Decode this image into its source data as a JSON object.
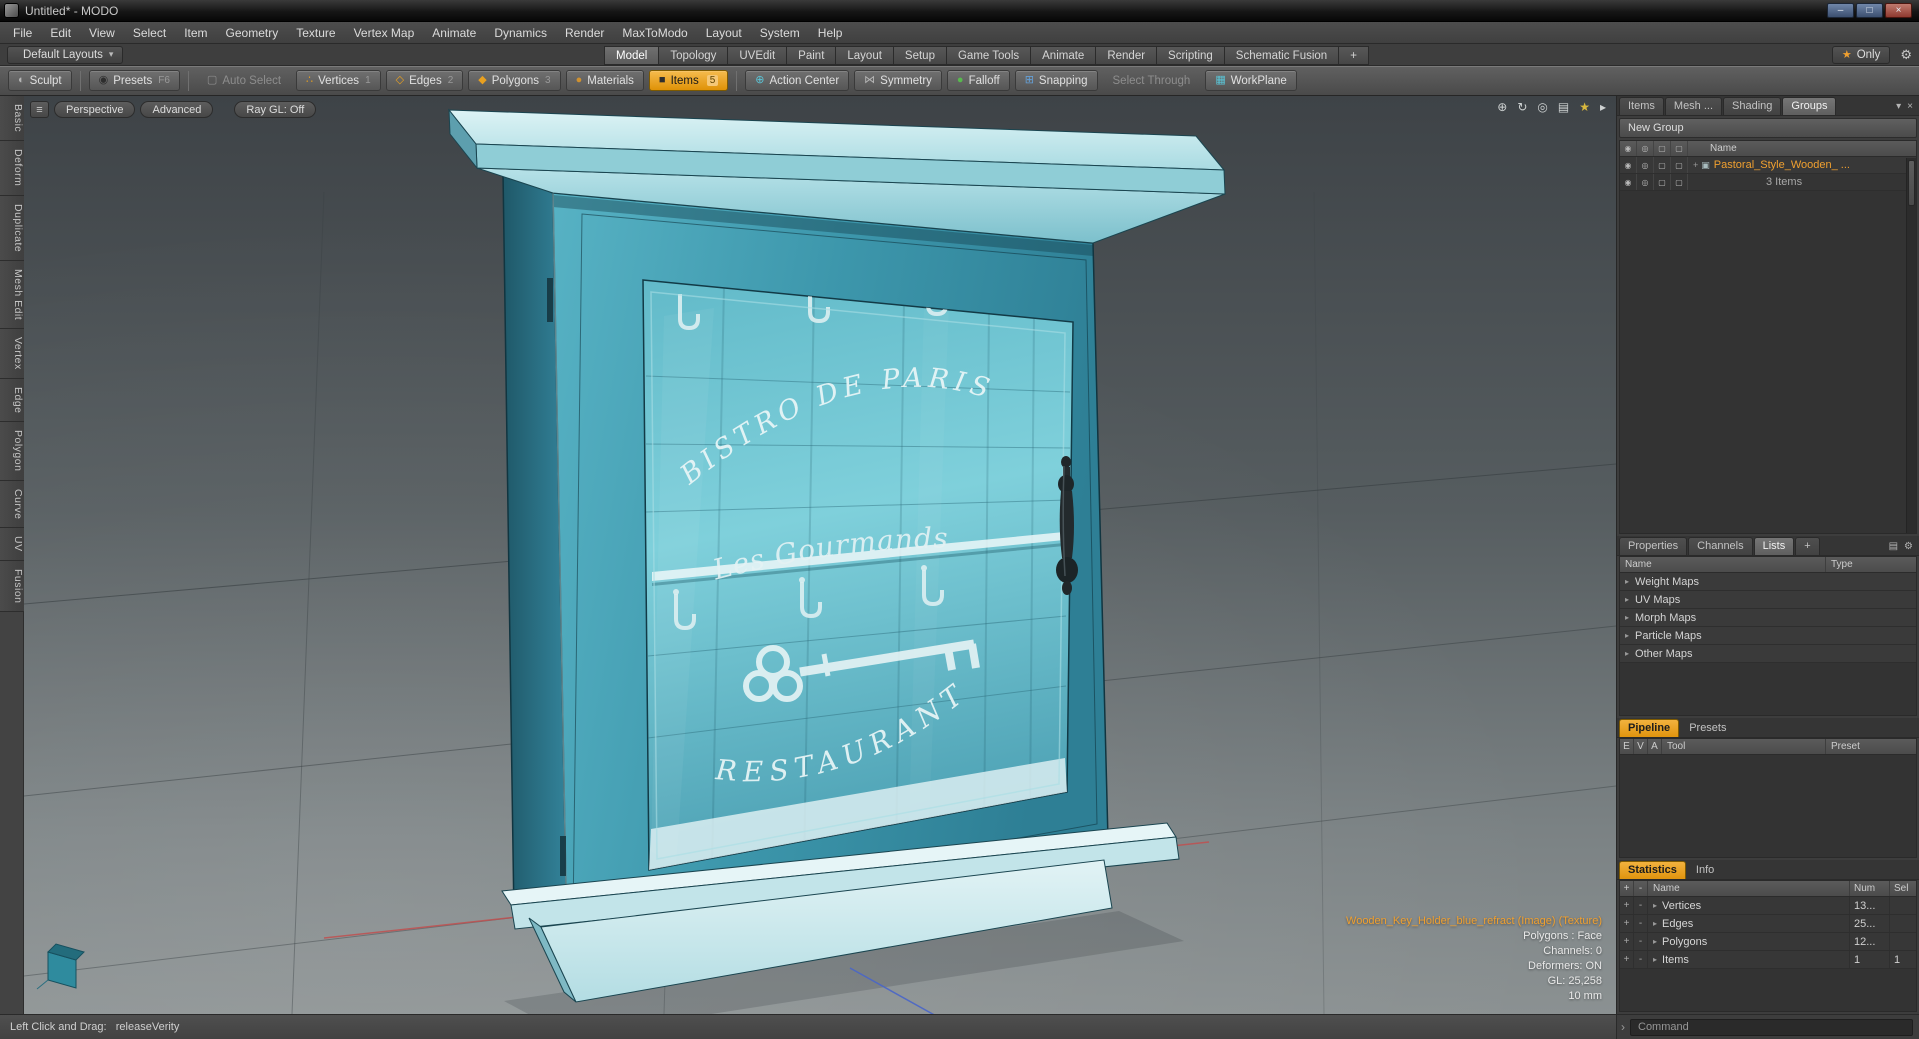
{
  "window": {
    "title": "Untitled* - MODO"
  },
  "icons": {
    "minimize": "–",
    "maximize": "□",
    "close": "×",
    "dropdown": "▾",
    "star": "★",
    "gear": "⚙",
    "pin": "▪",
    "sculpt": "◐",
    "presets": "◉",
    "auto_select": "▢",
    "vertices": "∴",
    "edges": "◇",
    "polygons": "◆",
    "materials": "●",
    "items": "■",
    "action_center": "⊕",
    "symmetry": "⋈",
    "falloff": "●",
    "snapping": "⊞",
    "workplane": "▦",
    "viewport_menu": "≡",
    "nav_move": "⊕",
    "nav_rotate": "↻",
    "nav_zoom": "◎",
    "nav_grid": "▤",
    "nav_star": "★",
    "nav_arrow": "▸",
    "eye": "◉",
    "shade": "◎",
    "box": "▢",
    "expander": "▸",
    "expander_plus": "+",
    "group": "▣",
    "collapse": "›"
  },
  "menu": {
    "items": [
      "File",
      "Edit",
      "View",
      "Select",
      "Item",
      "Geometry",
      "Texture",
      "Vertex Map",
      "Animate",
      "Dynamics",
      "Render",
      "MaxToModo",
      "Layout",
      "System",
      "Help"
    ]
  },
  "layout_bar": {
    "layouts_button": "Default Layouts",
    "tabs": [
      "Model",
      "Topology",
      "UVEdit",
      "Paint",
      "Layout",
      "Setup",
      "Game Tools",
      "Animate",
      "Render",
      "Scripting",
      "Schematic Fusion"
    ],
    "add_tab": "+",
    "only_label": "Only"
  },
  "toolbar": {
    "sculpt": "Sculpt",
    "presets": "Presets",
    "presets_key": "F6",
    "auto_select": "Auto Select",
    "vertices": "Vertices",
    "vertices_key": "1",
    "edges": "Edges",
    "edges_key": "2",
    "polygons": "Polygons",
    "polygons_key": "3",
    "materials": "Materials",
    "items": "Items",
    "items_key": "5",
    "action_center": "Action Center",
    "symmetry": "Symmetry",
    "falloff": "Falloff",
    "snapping": "Snapping",
    "select_through": "Select Through",
    "workplane": "WorkPlane"
  },
  "left_tabs": [
    "Basic",
    "Deform",
    "Duplicate",
    "Mesh Edit",
    "Vertex",
    "Edge",
    "Polygon",
    "Curve",
    "UV",
    "Fusion"
  ],
  "viewport": {
    "buttons": [
      "Perspective",
      "Advanced",
      "Ray GL: Off"
    ],
    "model": {
      "arc_text_top": "BISTRO DE PARIS",
      "script_text": "Les Gourmands",
      "arc_text_bottom": "RESTAURANT"
    },
    "info": {
      "texture": "Wooden_Key_Holder_blue_refract (Image) (Texture)",
      "line2": "Polygons : Face",
      "line3": "Channels: 0",
      "line4": "Deformers: ON",
      "line5": "GL: 25,258",
      "line6": "10 mm"
    }
  },
  "right_panel": {
    "tabs": [
      "Items",
      "Mesh ...",
      "Shading",
      "Groups"
    ],
    "new_group_button": "New Group",
    "tree": {
      "name_header": "Name",
      "group_name": "Pastoral_Style_Wooden_ ...",
      "group_items": "3 Items"
    },
    "lower_tabs": [
      "Properties",
      "Channels",
      "Lists",
      "+"
    ],
    "lists": {
      "name_header": "Name",
      "type_header": "Type",
      "rows": [
        "Weight Maps",
        "UV Maps",
        "Morph Maps",
        "Particle Maps",
        "Other Maps"
      ]
    },
    "pipeline": {
      "tab": "Pipeline",
      "alt_tab": "Presets",
      "col_e": "E",
      "col_v": "V",
      "col_a": "A",
      "col_tool": "Tool",
      "col_preset": "Preset"
    },
    "statistics": {
      "tab": "Statistics",
      "alt_tab": "Info",
      "col_plus": "+",
      "col_minus": "-",
      "col_name": "Name",
      "col_num": "Num",
      "col_sel": "Sel",
      "rows": [
        {
          "name": "Vertices",
          "num": "13...",
          "sel": ""
        },
        {
          "name": "Edges",
          "num": "25...",
          "sel": ""
        },
        {
          "name": "Polygons",
          "num": "12...",
          "sel": ""
        },
        {
          "name": "Items",
          "num": "1",
          "sel": "1"
        }
      ]
    }
  },
  "status_bar": {
    "left_text": "Left Click and Drag:   releaseVerity",
    "command_placeholder": "Command"
  },
  "colors": {
    "accent_orange": "#e8a020",
    "name_orange": "#f0a030",
    "teal_front": "#3f9ab0"
  }
}
